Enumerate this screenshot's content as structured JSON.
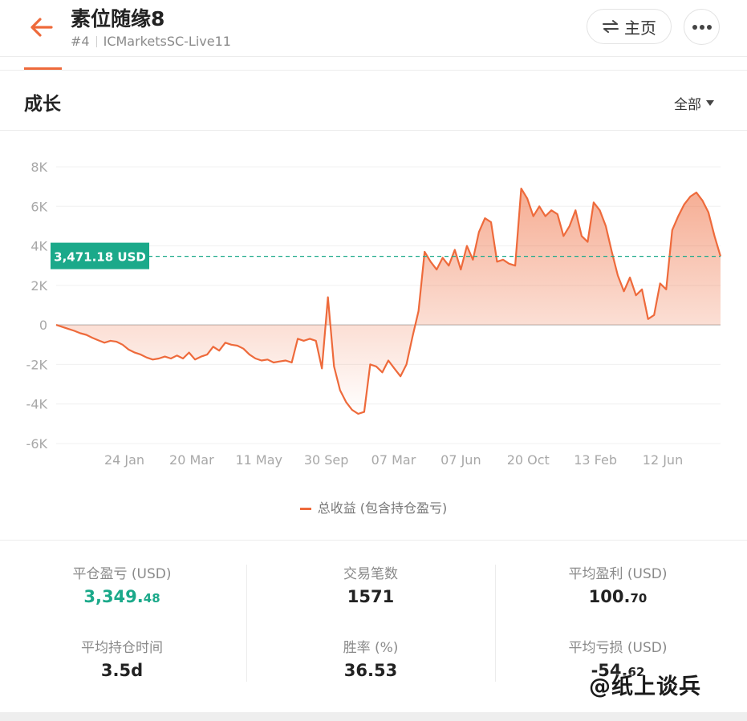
{
  "header": {
    "title": "素位随缘8",
    "rank": "#4",
    "server": "ICMarketsSC-Live11",
    "home_label": "主页"
  },
  "section": {
    "title": "成长",
    "range_label": "全部"
  },
  "chart_data": {
    "type": "area",
    "title": "",
    "xlabel": "",
    "ylabel": "",
    "ylim": [
      -6000,
      8000
    ],
    "y_ticks": [
      "8K",
      "6K",
      "4K",
      "2K",
      "0",
      "-2K",
      "-4K",
      "-6K"
    ],
    "x_ticks": [
      "24 Jan",
      "20 Mar",
      "11 May",
      "30 Sep",
      "07 Mar",
      "07 Jun",
      "20 Oct",
      "13 Feb",
      "12 Jun"
    ],
    "series": [
      {
        "name": "总收益 (包含持仓盈亏)",
        "color": "#ee6a3b",
        "values": [
          0,
          -100,
          -200,
          -300,
          -420,
          -500,
          -650,
          -780,
          -900,
          -800,
          -850,
          -1000,
          -1250,
          -1400,
          -1500,
          -1650,
          -1750,
          -1700,
          -1600,
          -1700,
          -1550,
          -1700,
          -1400,
          -1750,
          -1600,
          -1500,
          -1100,
          -1300,
          -900,
          -1000,
          -1050,
          -1200,
          -1500,
          -1700,
          -1800,
          -1750,
          -1900,
          -1850,
          -1800,
          -1900,
          -700,
          -800,
          -700,
          -800,
          -2200,
          1400,
          -2100,
          -3300,
          -3900,
          -4300,
          -4500,
          -4400,
          -2000,
          -2100,
          -2400,
          -1800,
          -2200,
          -2600,
          -2000,
          -600,
          700,
          3700,
          3200,
          2800,
          3400,
          3000,
          3800,
          2800,
          4000,
          3300,
          4700,
          5400,
          5200,
          3200,
          3300,
          3100,
          3000,
          6900,
          6400,
          5500,
          6000,
          5500,
          5800,
          5600,
          4500,
          5000,
          5800,
          4500,
          4200,
          6200,
          5800,
          5000,
          3700,
          2500,
          1700,
          2400,
          1500,
          1800,
          300,
          500,
          2100,
          1800,
          4800,
          5500,
          6100,
          6500,
          6700,
          6300,
          5700,
          4500,
          3471.18
        ]
      }
    ],
    "marker": {
      "value": 3471.18,
      "label": "3,471.18 USD",
      "color": "#1ba98a"
    }
  },
  "stats": {
    "closed_pnl": {
      "label": "平仓盈亏 (USD)",
      "int": "3,349.",
      "dec": "48"
    },
    "avg_hold": {
      "label": "平均持仓时间",
      "value": "3.5d"
    },
    "trades": {
      "label": "交易笔数",
      "value": "1571"
    },
    "win_rate": {
      "label": "胜率 (%)",
      "value": "36.53"
    },
    "avg_profit": {
      "label": "平均盈利 (USD)",
      "int": "100.",
      "dec": "70"
    },
    "avg_loss": {
      "label": "平均亏损 (USD)",
      "int": "-54.",
      "dec": "62"
    }
  },
  "watermark": "@纸上谈兵",
  "colors": {
    "accent": "#ee6a3b",
    "positive": "#1ba98a"
  }
}
